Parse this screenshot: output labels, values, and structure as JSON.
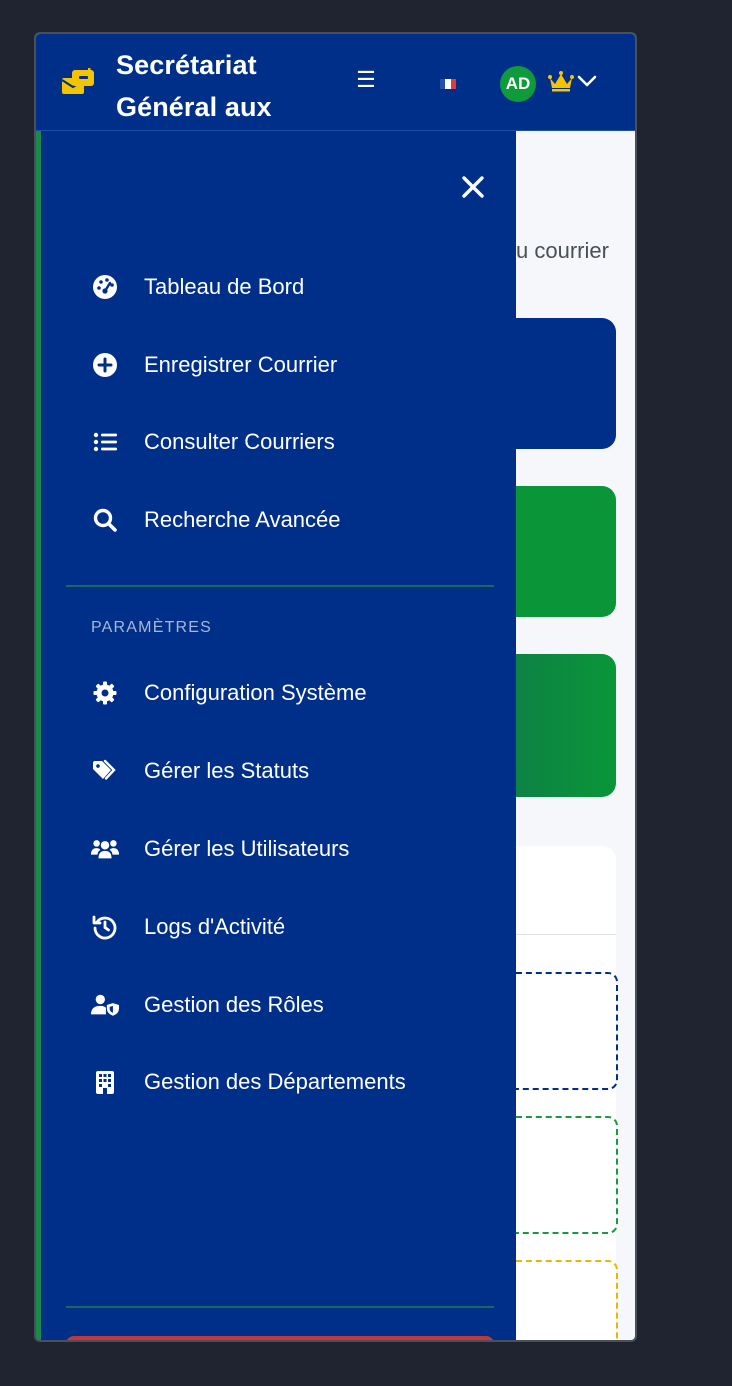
{
  "header": {
    "brand_title": "Secrétariat Général aux",
    "menu_icon": "hamburger-icon",
    "language_flag": "france-flag-icon",
    "avatar_initials": "AD",
    "crown_icon": "crown-icon",
    "dropdown_icon": "chevron-down-icon"
  },
  "background": {
    "subtitle_fragment": "u courrier"
  },
  "sidebar": {
    "close_icon": "close-icon",
    "main_items": [
      {
        "label": "Tableau de Bord",
        "icon": "dashboard-gauge-icon"
      },
      {
        "label": "Enregistrer Courrier",
        "icon": "plus-circle-icon"
      },
      {
        "label": "Consulter Courriers",
        "icon": "list-icon"
      },
      {
        "label": "Recherche Avancée",
        "icon": "search-icon"
      }
    ],
    "section_title": "PARAMÈTRES",
    "settings_items": [
      {
        "label": "Configuration Système",
        "icon": "gear-icon"
      },
      {
        "label": "Gérer les Statuts",
        "icon": "tags-icon"
      },
      {
        "label": "Gérer les Utilisateurs",
        "icon": "users-icon"
      },
      {
        "label": "Logs d'Activité",
        "icon": "history-icon"
      },
      {
        "label": "Gestion des Rôles",
        "icon": "user-shield-icon"
      },
      {
        "label": "Gestion des Départements",
        "icon": "building-icon"
      }
    ]
  },
  "colors": {
    "primary": "#002f8a",
    "green": "#0a9638",
    "accent_yellow": "#f5c400",
    "logout_red": "#c0393b"
  }
}
